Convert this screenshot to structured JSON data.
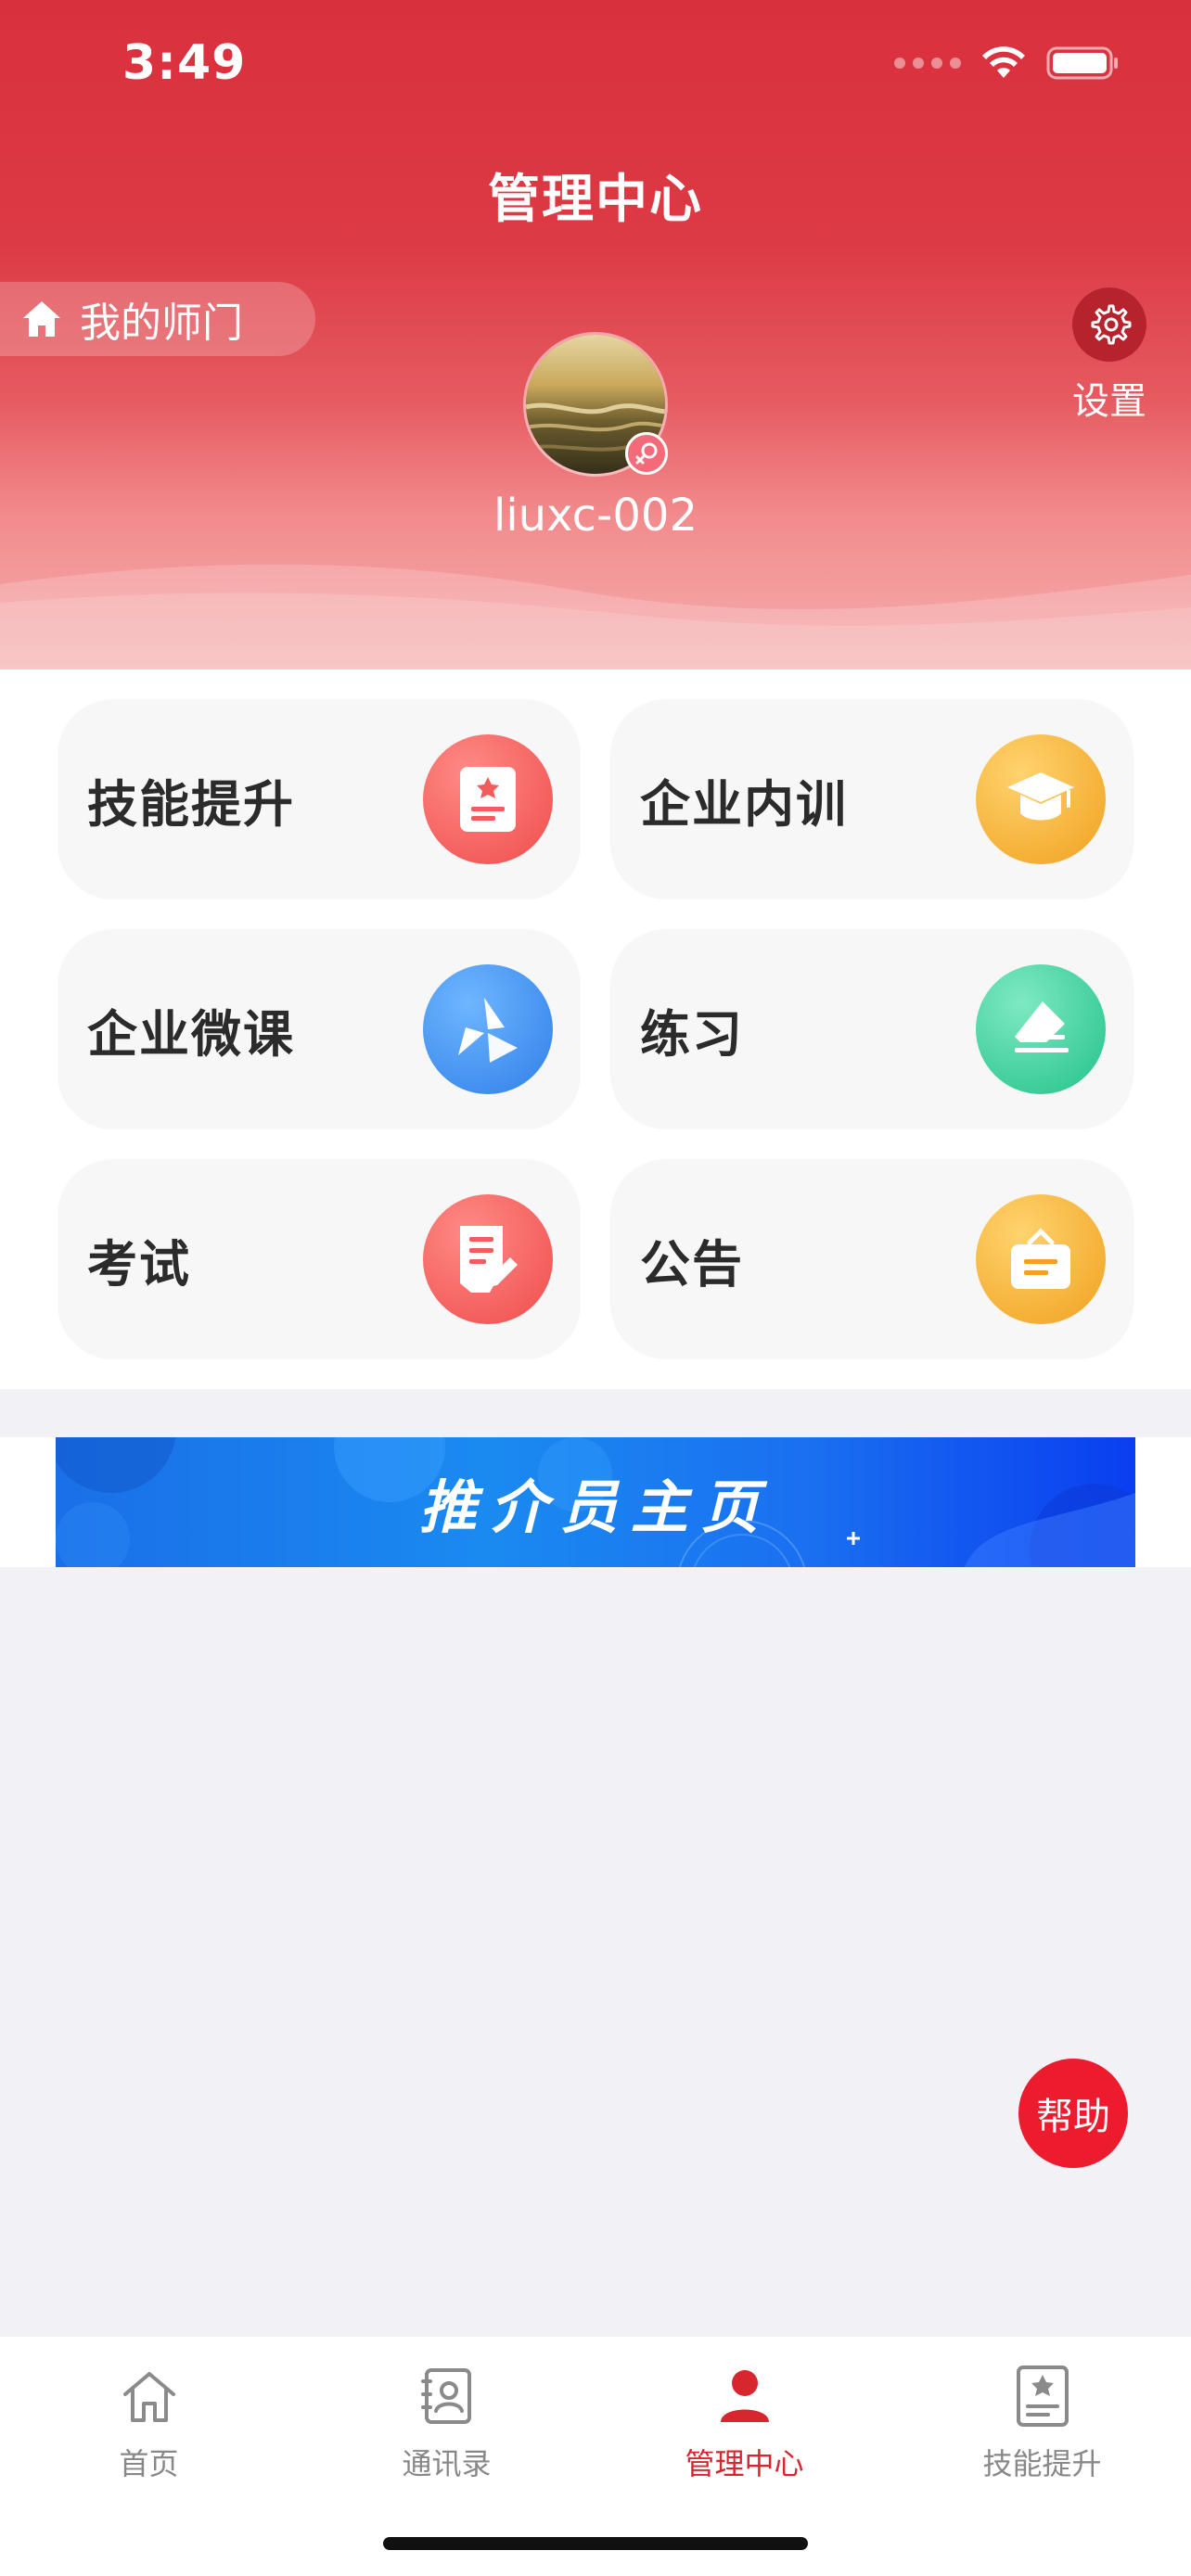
{
  "status_bar": {
    "time": "3:49"
  },
  "header": {
    "title": "管理中心",
    "my_master_label": "我的师门",
    "settings_label": "设置",
    "username": "liuxc-002"
  },
  "menu": {
    "items": [
      {
        "label": "技能提升",
        "icon": "skill-book-icon",
        "color": "#f25c5c"
      },
      {
        "label": "企业内训",
        "icon": "graduation-cap-icon",
        "color": "#f4a829"
      },
      {
        "label": "企业微课",
        "icon": "pinwheel-icon",
        "color": "#3a8ef0"
      },
      {
        "label": "练习",
        "icon": "eraser-icon",
        "color": "#2ec996"
      },
      {
        "label": "考试",
        "icon": "exam-paper-icon",
        "color": "#f25c5c"
      },
      {
        "label": "公告",
        "icon": "notice-board-icon",
        "color": "#f4a829"
      }
    ]
  },
  "banner": {
    "text": "推介员主页"
  },
  "help_button": {
    "label": "帮助"
  },
  "tabbar": {
    "items": [
      {
        "label": "首页",
        "icon": "home-icon",
        "active": false
      },
      {
        "label": "通讯录",
        "icon": "contacts-icon",
        "active": false
      },
      {
        "label": "管理中心",
        "icon": "user-icon",
        "active": true
      },
      {
        "label": "技能提升",
        "icon": "skill-book-icon",
        "active": false
      }
    ],
    "active_color": "#d8262f"
  }
}
